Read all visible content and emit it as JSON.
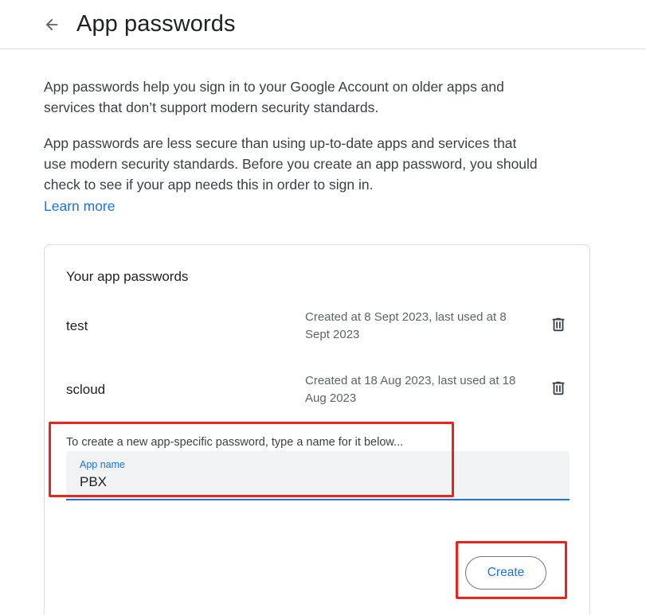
{
  "header": {
    "title": "App passwords",
    "back_icon": "arrow-back-icon"
  },
  "intro": {
    "paragraph1": "App passwords help you sign in to your Google Account on older apps and services that don’t support modern security standards.",
    "paragraph2": "App passwords are less secure than using up-to-date apps and services that use modern security standards. Before you create an app password, you should check to see if your app needs this in order to sign in.",
    "learn_more": "Learn more"
  },
  "card": {
    "title": "Your app passwords",
    "passwords": [
      {
        "name": "test",
        "meta": "Created at 8 Sept 2023, last used at 8 Sept 2023"
      },
      {
        "name": "scloud",
        "meta": "Created at 18 Aug 2023, last used at 18 Aug 2023"
      }
    ],
    "delete_icon": "trash-icon",
    "hint": "To create a new app-specific password, type a name for it below...",
    "field_label": "App name",
    "field_value": "PBX",
    "create_label": "Create"
  },
  "colors": {
    "accent": "#1a73e8",
    "annotation": "#e8251c",
    "text_primary": "#202124",
    "text_secondary": "#5f6368",
    "field_bg": "#f1f3f4"
  }
}
